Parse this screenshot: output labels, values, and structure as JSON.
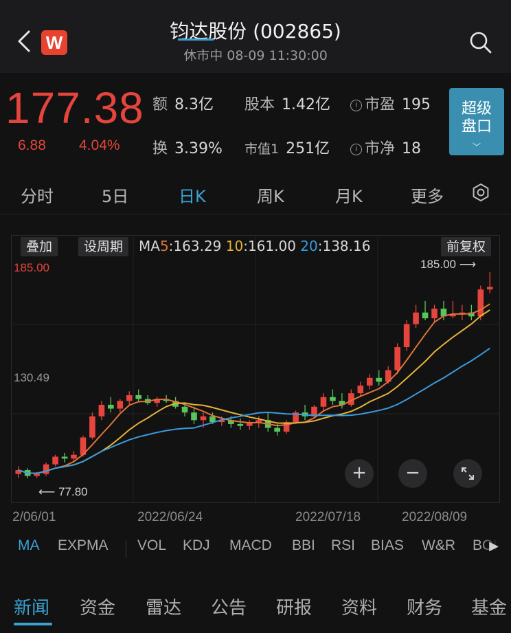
{
  "header": {
    "title": "钧达股份 (002865)",
    "subtitle": "休市中 08-09 11:30:00",
    "logo_text": "W",
    "back_icon": "chevron-left-icon",
    "search_icon": "search-icon"
  },
  "quote": {
    "price": "177.38",
    "change": "6.88",
    "change_pct": "4.04%",
    "stats": {
      "amount_label": "额",
      "amount": "8.3亿",
      "share_label": "股本",
      "share": "1.42亿",
      "pe_label": "市盈",
      "pe": "195",
      "turnover_label": "换",
      "turnover": "3.39%",
      "mktcap_label": "市值1",
      "mktcap": "251亿",
      "pb_label": "市净",
      "pb": "18"
    },
    "super_button": {
      "line1": "超级",
      "line2": "盘口",
      "chevron": "﹀"
    }
  },
  "period_tabs": [
    "分时",
    "5日",
    "日K",
    "周K",
    "月K",
    "更多"
  ],
  "period_active": "日K",
  "chart_toolbar": {
    "overlay": "叠加",
    "set_period": "设周期",
    "adjust": "前复权",
    "ma_label": "MA",
    "ma5_key": "5",
    "ma5_val": ":163.29",
    "ma10_key": "10",
    "ma10_val": ":161.00",
    "ma20_key": "20",
    "ma20_val": ":138.16"
  },
  "chart_labels": {
    "high": "185.00",
    "mid": "130.49",
    "max_marker": "185.00 ⟶",
    "min_marker": "⟵ 77.80",
    "dates": [
      "2/06/01",
      "2022/06/24",
      "2022/07/18",
      "2022/08/09"
    ]
  },
  "zoom": {
    "plus": "+",
    "minus": "−",
    "expand_icon": "expand-icon"
  },
  "indicator_tabs": [
    "MA",
    "EXPMA",
    "VOL",
    "KDJ",
    "MACD",
    "BBI",
    "RSI",
    "BIAS",
    "W&R",
    "BOL"
  ],
  "indicator_active": "MA",
  "bottom_tabs": [
    "新闻",
    "资金",
    "雷达",
    "公告",
    "研报",
    "资料",
    "财务",
    "基金"
  ],
  "bottom_active": "新闻",
  "colors": {
    "up": "#e5453c",
    "down": "#58c65a",
    "ma5": "#e0743a",
    "ma10": "#e6b23a",
    "ma20": "#3a9bdc",
    "accent": "#3aa3d4"
  },
  "chart_data": {
    "type": "candlestick",
    "ylim": [
      72,
      190
    ],
    "y_ticks": [
      185.0,
      130.49
    ],
    "candles": [
      [
        80,
        84,
        78,
        82
      ],
      [
        82,
        83,
        77.8,
        79
      ],
      [
        79,
        81,
        78,
        80
      ],
      [
        80,
        86,
        79,
        85
      ],
      [
        85,
        90,
        84,
        89
      ],
      [
        89,
        91,
        86,
        88
      ],
      [
        88,
        92,
        86,
        90
      ],
      [
        90,
        100,
        89,
        99
      ],
      [
        99,
        112,
        98,
        110
      ],
      [
        110,
        118,
        108,
        116
      ],
      [
        116,
        120,
        112,
        114
      ],
      [
        114,
        119,
        112,
        118
      ],
      [
        118,
        123,
        116,
        121
      ],
      [
        121,
        124,
        118,
        119
      ],
      [
        119,
        121,
        116,
        117
      ],
      [
        117,
        120,
        115,
        119
      ],
      [
        119,
        121,
        117,
        118
      ],
      [
        118,
        120,
        114,
        115
      ],
      [
        115,
        117,
        110,
        112
      ],
      [
        112,
        115,
        106,
        108
      ],
      [
        108,
        112,
        104,
        110
      ],
      [
        110,
        112,
        106,
        107
      ],
      [
        107,
        110,
        105,
        108
      ],
      [
        108,
        110,
        104,
        106
      ],
      [
        106,
        109,
        103,
        105
      ],
      [
        105,
        108,
        103,
        107
      ],
      [
        107,
        110,
        104,
        108
      ],
      [
        108,
        112,
        102,
        104
      ],
      [
        104,
        106,
        100,
        102
      ],
      [
        102,
        108,
        101,
        107
      ],
      [
        107,
        113,
        106,
        112
      ],
      [
        112,
        116,
        108,
        110
      ],
      [
        110,
        116,
        109,
        115
      ],
      [
        115,
        122,
        113,
        120
      ],
      [
        120,
        124,
        116,
        118
      ],
      [
        118,
        122,
        114,
        116
      ],
      [
        116,
        124,
        115,
        122
      ],
      [
        122,
        128,
        120,
        126
      ],
      [
        126,
        132,
        124,
        130
      ],
      [
        130,
        134,
        126,
        128
      ],
      [
        128,
        136,
        127,
        134
      ],
      [
        134,
        148,
        132,
        146
      ],
      [
        146,
        160,
        144,
        158
      ],
      [
        158,
        168,
        156,
        164
      ],
      [
        164,
        170,
        160,
        161
      ],
      [
        161,
        168,
        159,
        166
      ],
      [
        166,
        170,
        160,
        162
      ],
      [
        162,
        170,
        161,
        163
      ],
      [
        163,
        168,
        160,
        164
      ],
      [
        164,
        168,
        160,
        162
      ],
      [
        162,
        178,
        160,
        176
      ],
      [
        176,
        185,
        174,
        177.38
      ]
    ]
  }
}
